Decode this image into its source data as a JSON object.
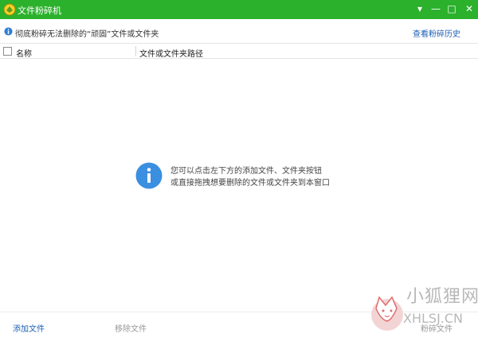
{
  "window": {
    "title": "文件粉碎机",
    "controls": {
      "menu": "▾",
      "minimize": "—",
      "maximize": "□",
      "close": "✕"
    },
    "accent_color": "#2bb12c"
  },
  "infobar": {
    "icon": "info-icon",
    "text": "彻底粉碎无法删除的“顽固”文件或文件夹",
    "history_link": "查看粉碎历史"
  },
  "table": {
    "columns": [
      {
        "label": "名称"
      },
      {
        "label": "文件或文件夹路径"
      }
    ],
    "rows": []
  },
  "empty_state": {
    "icon": "info-icon",
    "line1": "您可以点击左下方的添加文件、文件夹按钮",
    "line2": "或直接拖拽想要删除的文件或文件夹到本窗口"
  },
  "bottombar": {
    "add_file": "添加文件",
    "remove_file": "移除文件",
    "shred_file": "粉碎文件"
  },
  "watermark": {
    "logo": "fox-logo-icon",
    "text_cn": "小狐狸网",
    "text_en": "XHLSJ.CN"
  }
}
